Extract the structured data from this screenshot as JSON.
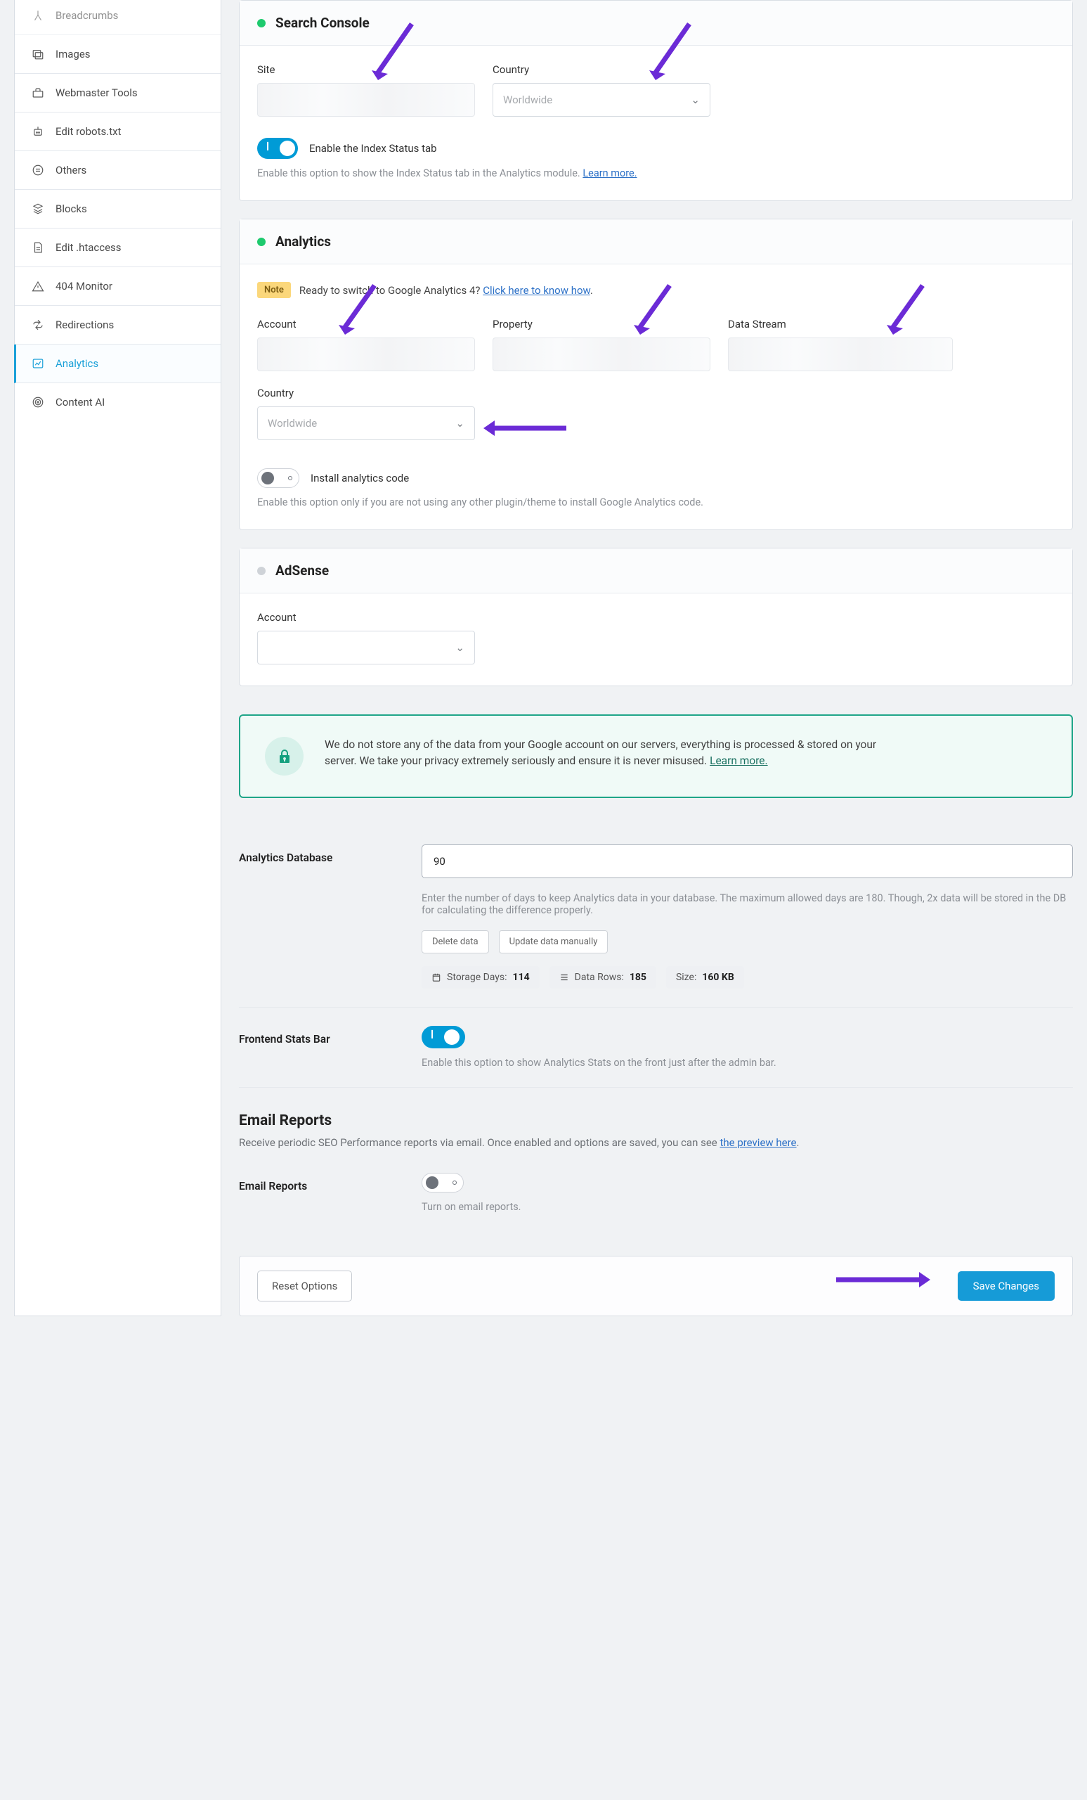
{
  "sidebar": {
    "items": [
      {
        "label": "Breadcrumbs",
        "icon": "breadcrumbs"
      },
      {
        "label": "Images",
        "icon": "images"
      },
      {
        "label": "Webmaster Tools",
        "icon": "toolbox"
      },
      {
        "label": "Edit robots.txt",
        "icon": "robot"
      },
      {
        "label": "Others",
        "icon": "list"
      },
      {
        "label": "Blocks",
        "icon": "blocks"
      },
      {
        "label": "Edit .htaccess",
        "icon": "file"
      },
      {
        "label": "404 Monitor",
        "icon": "warning"
      },
      {
        "label": "Redirections",
        "icon": "redirect"
      },
      {
        "label": "Analytics",
        "icon": "chart",
        "active": true
      },
      {
        "label": "Content AI",
        "icon": "target"
      }
    ]
  },
  "search_console": {
    "title": "Search Console",
    "site_label": "Site",
    "country_label": "Country",
    "country_value": "Worldwide",
    "toggle_label": "Enable the Index Status tab",
    "help": "Enable this option to show the Index Status tab in the Analytics module. ",
    "help_link": "Learn more."
  },
  "analytics": {
    "title": "Analytics",
    "note_badge": "Note",
    "note_text_a": "Ready to switch to Google Analytics 4? ",
    "note_link": "Click here to know how",
    "account_label": "Account",
    "property_label": "Property",
    "datastream_label": "Data Stream",
    "country_label": "Country",
    "country_value": "Worldwide",
    "install_toggle": "Install analytics code",
    "install_help": "Enable this option only if you are not using any other plugin/theme to install Google Analytics code."
  },
  "adsense": {
    "title": "AdSense",
    "account_label": "Account"
  },
  "privacy": {
    "text": "We do not store any of the data from your Google account on our servers, everything is processed & stored on your server. We take your privacy extremely seriously and ensure it is never misused. ",
    "link": "Learn more."
  },
  "db": {
    "label": "Analytics Database",
    "value": "90",
    "help": "Enter the number of days to keep Analytics data in your database. The maximum allowed days are 180. Though, 2x data will be stored in the DB for calculating the difference properly.",
    "delete_btn": "Delete data",
    "update_btn": "Update data manually",
    "storage_label": "Storage Days: ",
    "storage_value": "114",
    "rows_label": "Data Rows: ",
    "rows_value": "185",
    "size_label": "Size: ",
    "size_value": "160 KB"
  },
  "frontend": {
    "label": "Frontend Stats Bar",
    "help": "Enable this option to show Analytics Stats on the front just after the admin bar."
  },
  "email": {
    "section_title": "Email Reports",
    "intro_a": "Receive periodic SEO Performance reports via email. Once enabled and options are saved, you can see ",
    "intro_link": "the preview here",
    "label": "Email Reports",
    "help": "Turn on email reports."
  },
  "footer": {
    "reset": "Reset Options",
    "save": "Save Changes"
  }
}
